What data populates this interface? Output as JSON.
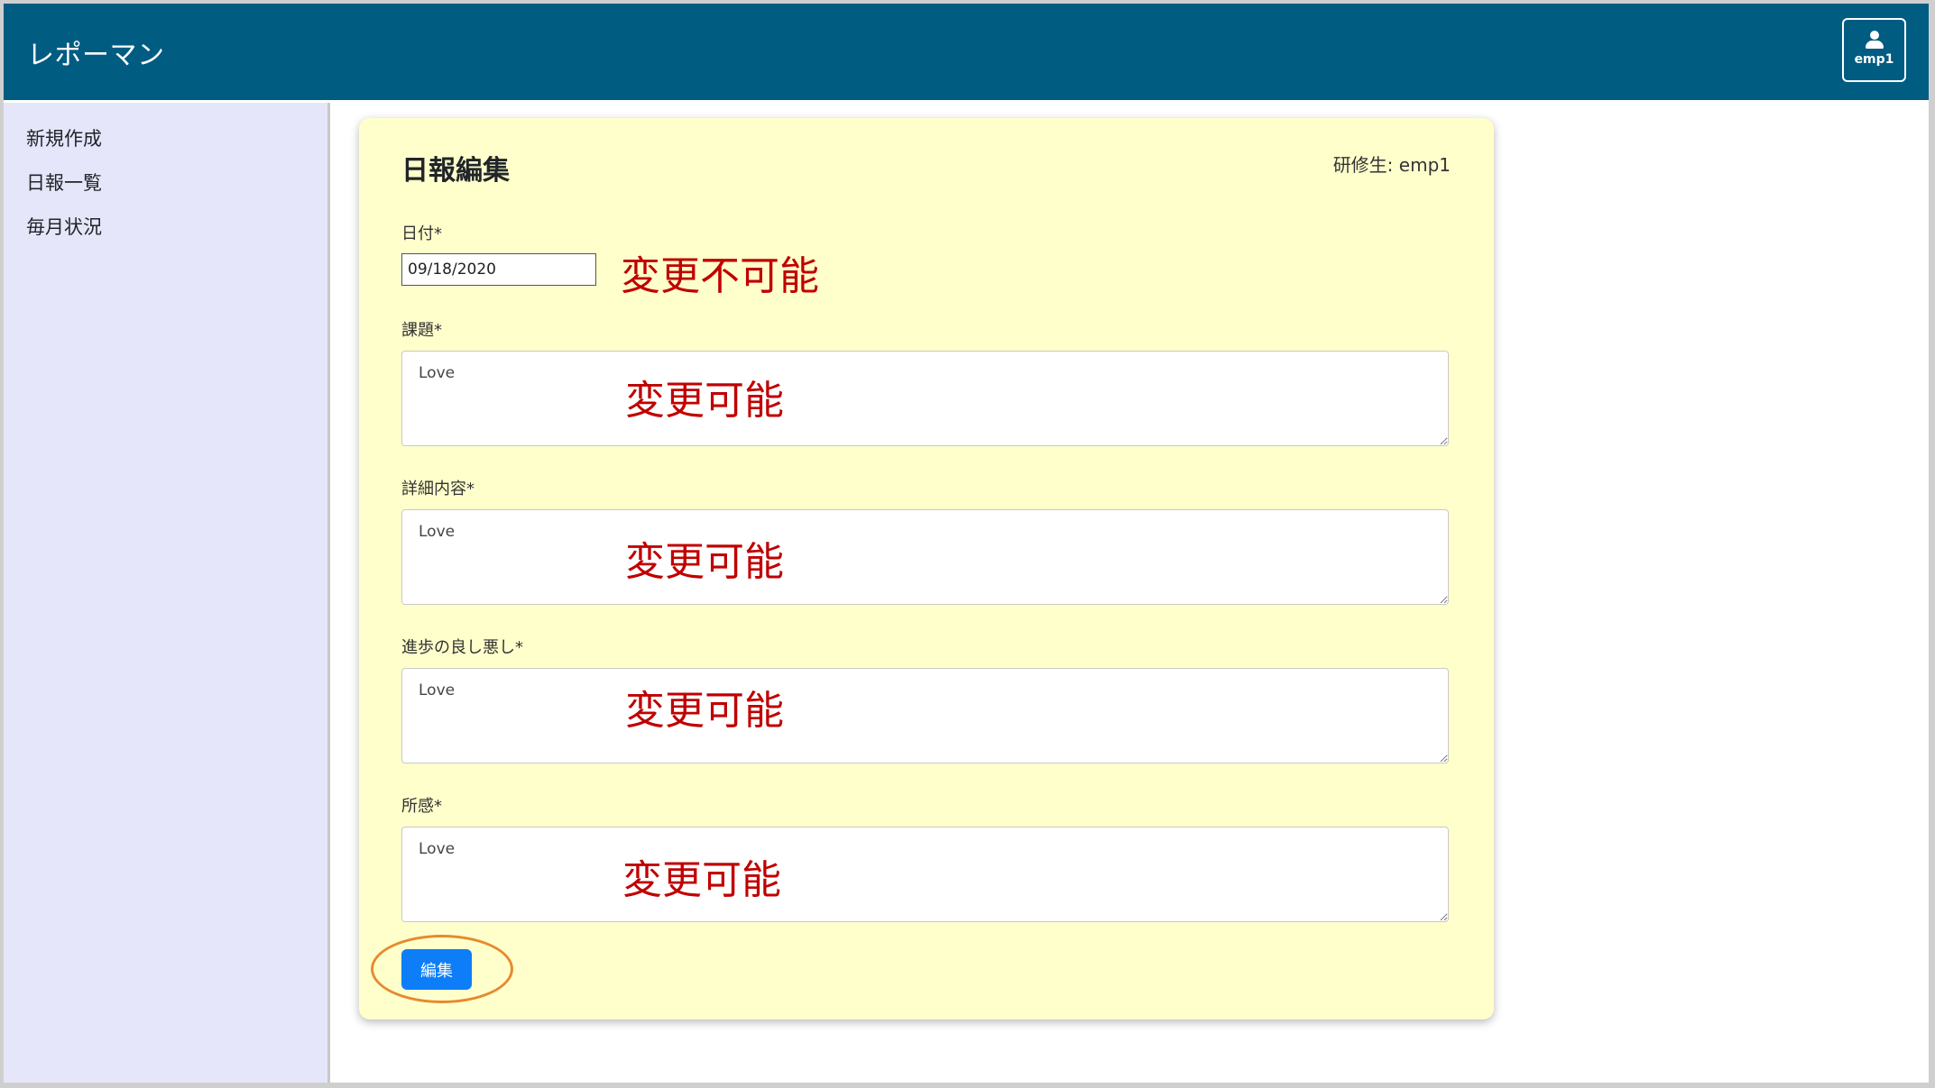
{
  "app": {
    "brand": "レポーマン",
    "user": "emp1"
  },
  "sidebar": {
    "items": [
      {
        "label": "新規作成"
      },
      {
        "label": "日報一覧"
      },
      {
        "label": "毎月状況"
      }
    ]
  },
  "form": {
    "title": "日報編集",
    "trainee": "研修生: emp1",
    "date_label": "日付*",
    "date_value": "09/18/2020",
    "fields": [
      {
        "label": "課題*",
        "value": "Love"
      },
      {
        "label": "詳細内容*",
        "value": "Love"
      },
      {
        "label": "進歩の良し悪し*",
        "value": "Love"
      },
      {
        "label": "所感*",
        "value": "Love"
      }
    ],
    "submit_label": "編集"
  },
  "annotations": {
    "date_note": "変更不可能",
    "field_notes": [
      "変更可能",
      "変更可能",
      "変更可能",
      "変更可能"
    ]
  },
  "colors": {
    "navbar": "#015c82",
    "sidebar": "#e6e6fa",
    "card": "#ffffcc",
    "button": "#0d7ef8",
    "annotation": "#c00000",
    "ring": "#e68a2e"
  }
}
